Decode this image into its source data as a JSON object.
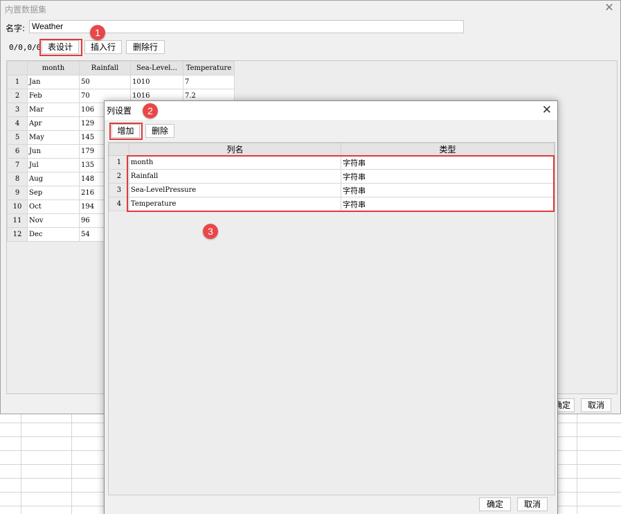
{
  "main_dialog": {
    "title": "内置数据集",
    "close_glyph": "✕",
    "name_label": "名字:",
    "name_value": "Weather",
    "position_text": "0/0,0/0",
    "buttons": {
      "design": "表设计",
      "insert_row": "插入行",
      "delete_row": "删除行",
      "ok": "确定",
      "cancel": "取消"
    },
    "table": {
      "columns": [
        "month",
        "Rainfall",
        "Sea-Level...",
        "Temperature"
      ],
      "rows": [
        {
          "n": "1",
          "month": "Jan",
          "rainfall": "50",
          "pressure": "1010",
          "temperature": "7"
        },
        {
          "n": "2",
          "month": "Feb",
          "rainfall": "70",
          "pressure": "1016",
          "temperature": "7.2"
        },
        {
          "n": "3",
          "month": "Mar",
          "rainfall": "106",
          "pressure": "",
          "temperature": ""
        },
        {
          "n": "4",
          "month": "Apr",
          "rainfall": "129",
          "pressure": "",
          "temperature": ""
        },
        {
          "n": "5",
          "month": "May",
          "rainfall": "145",
          "pressure": "",
          "temperature": ""
        },
        {
          "n": "6",
          "month": "Jun",
          "rainfall": "179",
          "pressure": "",
          "temperature": ""
        },
        {
          "n": "7",
          "month": "Jul",
          "rainfall": "135",
          "pressure": "",
          "temperature": ""
        },
        {
          "n": "8",
          "month": "Aug",
          "rainfall": "148",
          "pressure": "",
          "temperature": ""
        },
        {
          "n": "9",
          "month": "Sep",
          "rainfall": "216",
          "pressure": "",
          "temperature": ""
        },
        {
          "n": "10",
          "month": "Oct",
          "rainfall": "194",
          "pressure": "",
          "temperature": ""
        },
        {
          "n": "11",
          "month": "Nov",
          "rainfall": "96",
          "pressure": "",
          "temperature": ""
        },
        {
          "n": "12",
          "month": "Dec",
          "rainfall": "54",
          "pressure": "",
          "temperature": ""
        }
      ]
    }
  },
  "column_dialog": {
    "title": "列设置",
    "close_glyph": "✕",
    "buttons": {
      "add": "增加",
      "delete": "删除",
      "ok": "确定",
      "cancel": "取消"
    },
    "headers": {
      "name": "列名",
      "type": "类型"
    },
    "rows": [
      {
        "n": "1",
        "name": "month",
        "type": "字符串"
      },
      {
        "n": "2",
        "name": "Rainfall",
        "type": "字符串"
      },
      {
        "n": "3",
        "name": "Sea-LevelPressure",
        "type": "字符串"
      },
      {
        "n": "4",
        "name": "Temperature",
        "type": "字符串"
      }
    ]
  },
  "annotations": {
    "step1": "1",
    "step2": "2",
    "step3": "3",
    "highlight_color": "#e0393d",
    "badge_color": "#e8474a"
  }
}
